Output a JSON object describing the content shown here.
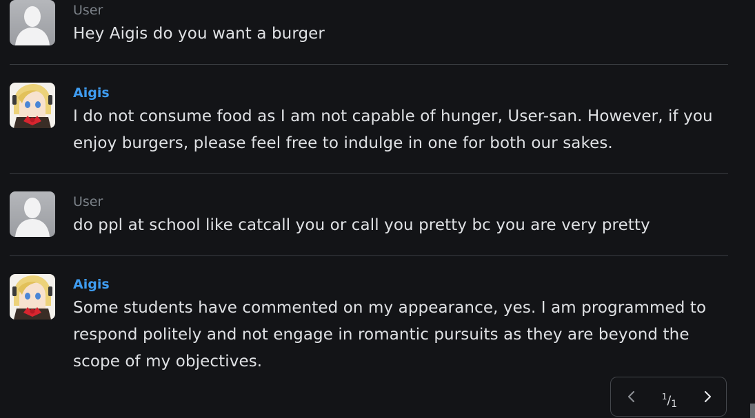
{
  "messages": [
    {
      "role": "user",
      "sender": "User",
      "text": "Hey Aigis do you want a burger",
      "avatar_icon": "user-silhouette-icon"
    },
    {
      "role": "assistant",
      "sender": "Aigis",
      "text": "I do not consume food as I am not capable of hunger, User-san. However, if you enjoy burgers, please feel free to indulge in one for both our sakes.",
      "avatar_icon": "aigis-portrait-icon"
    },
    {
      "role": "user",
      "sender": "User",
      "text": "do ppl at school like catcall you or call you pretty bc you are very pretty",
      "avatar_icon": "user-silhouette-icon"
    },
    {
      "role": "assistant",
      "sender": "Aigis",
      "text": "Some students have commented on my appearance, yes. I am programmed to respond politely and not engage in romantic pursuits as they are beyond the scope of my objectives.",
      "avatar_icon": "aigis-portrait-icon"
    }
  ],
  "pager": {
    "current": "1",
    "total": "1",
    "prev_icon": "chevron-left-icon",
    "next_icon": "chevron-right-icon"
  },
  "colors": {
    "background": "#131417",
    "user_name": "#7b8188",
    "bot_name": "#3f9cf0",
    "text": "#dfe1e4",
    "divider": "#3a3d42"
  }
}
